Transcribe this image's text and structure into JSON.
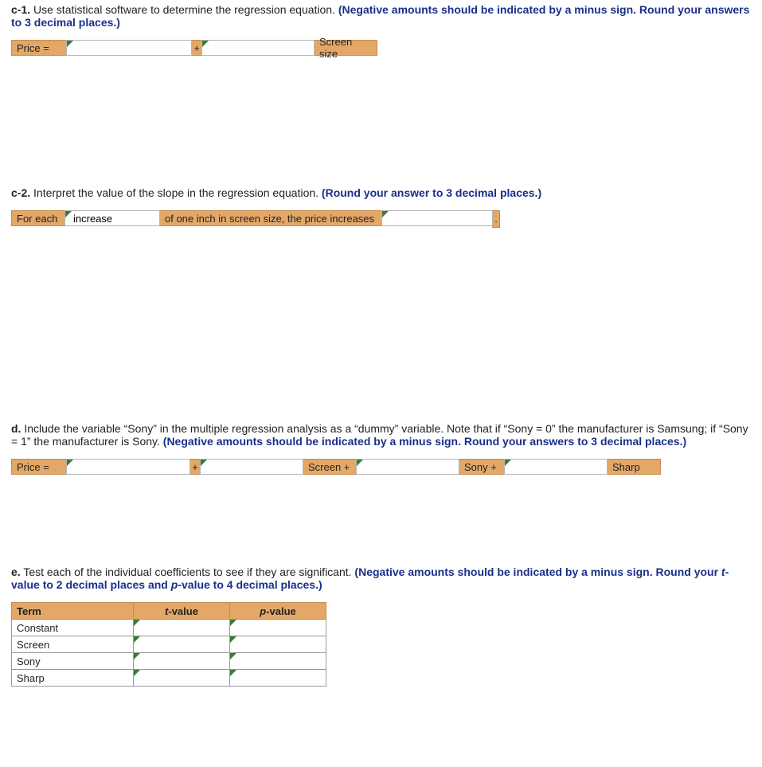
{
  "c1": {
    "label": "c-1.",
    "text": " Use statistical software to determine the regression equation. ",
    "note": "(Negative amounts should be indicated by a minus sign. Round your answers to 3 decimal places.)",
    "price_label": "Price =",
    "plus": "+",
    "screen_label": "Screen size",
    "intercept": "",
    "slope": ""
  },
  "c2": {
    "label": "c-2.",
    "text": " Interpret the value of the slope in the regression equation. ",
    "note": "(Round your answer to 3 decimal places.)",
    "for_each": "For each",
    "direction": "increase",
    "mid": "of one inch in screen size, the price increases",
    "amount": "",
    "period": "."
  },
  "d": {
    "label": "d.",
    "text": " Include the variable “Sony” in the multiple regression analysis as a “dummy” variable. Note that if “Sony = 0” the manufacturer is Samsung; if “Sony = 1” the manufacturer is Sony. ",
    "note": "(Negative amounts should be indicated by a minus sign. Round your answers to 3 decimal places.)",
    "price_label": "Price =",
    "plus": "+",
    "screen_plus": "Screen +",
    "sony_plus": "Sony +",
    "sharp": "Sharp",
    "b0": "",
    "b1": "",
    "b2": "",
    "b3": ""
  },
  "e": {
    "label": "e.",
    "text": " Test each of the individual coefficients to see if they are significant. ",
    "note_a": "(Negative amounts should be indicated by a minus sign. Round your ",
    "note_t": "t",
    "note_b": "-value to 2 decimal places and ",
    "note_p": "p",
    "note_c": "-value to 4 decimal places.)",
    "headers": {
      "term": "Term",
      "t": "t",
      "tval": "-value",
      "p": "p",
      "pval": "-value"
    },
    "rows": [
      {
        "term": "Constant",
        "t": "",
        "p": ""
      },
      {
        "term": "Screen",
        "t": "",
        "p": ""
      },
      {
        "term": "Sony",
        "t": "",
        "p": ""
      },
      {
        "term": "Sharp",
        "t": "",
        "p": ""
      }
    ]
  }
}
